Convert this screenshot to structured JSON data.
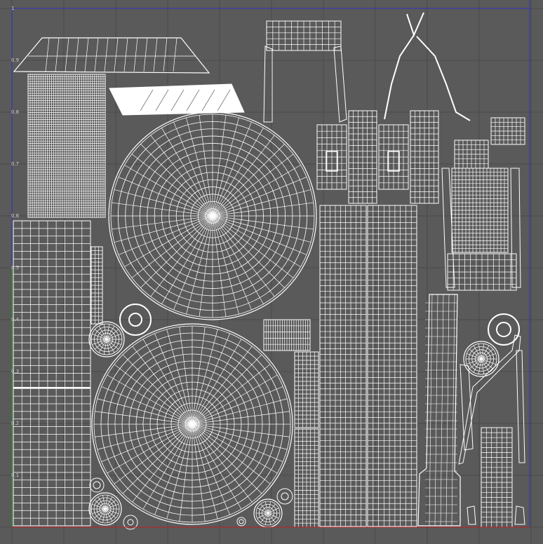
{
  "viewport": {
    "axis_labels": [
      "1",
      "0.9",
      "0.8",
      "0.7",
      "0.6",
      "0.5",
      "0.4",
      "0.3",
      "0.2",
      "0.1"
    ],
    "colors": {
      "background": "#5a5a5a",
      "grid": "#4a4a4a",
      "wire": "#ffffff",
      "u_axis": "#c02020",
      "v_axis": "#3030c0",
      "v_axis_lower": "#20a020"
    }
  }
}
